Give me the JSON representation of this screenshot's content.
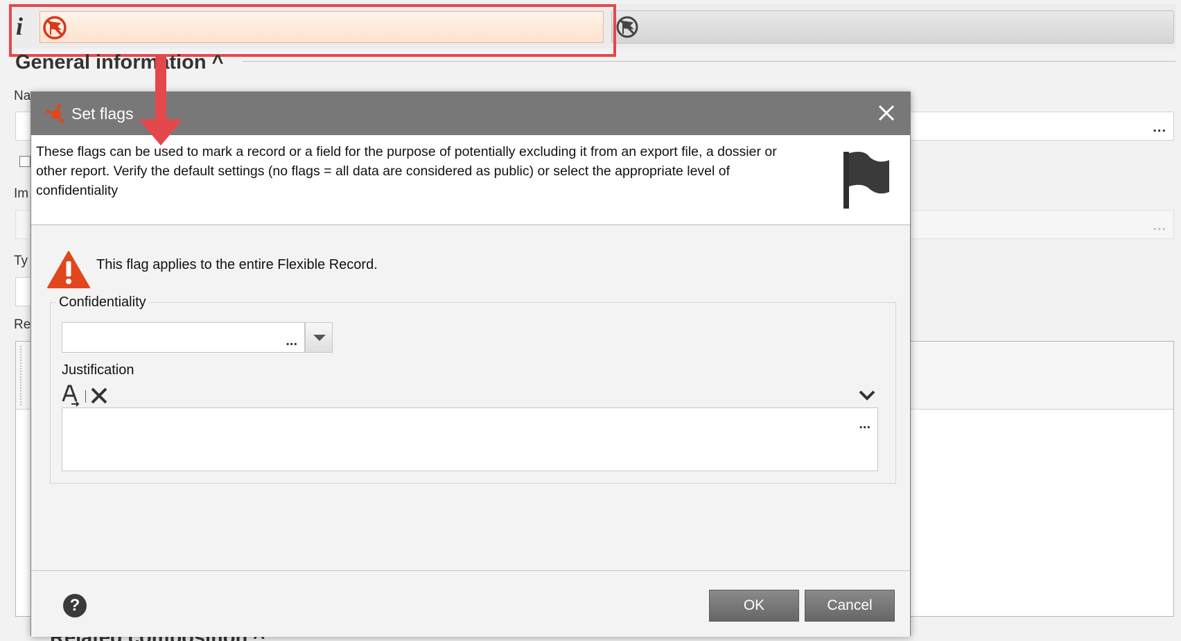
{
  "background": {
    "section_title": "General information ^",
    "labels": {
      "name": "Na",
      "impurity": "Im",
      "type": "Ty",
      "related": "Re"
    },
    "bottom_section_title": "Related composition ^",
    "field_dots": "..."
  },
  "flag_bar": {
    "info_icon": "i",
    "no_flag_icon": "no-flag-icon",
    "flag_icon": "flag-icon",
    "highlight_color": "#e4484c"
  },
  "dialog": {
    "title": "Set flags",
    "close_icon": "close-icon",
    "intro_text": "These flags can be used to mark a record or a field for the purpose of potentially excluding it from an export file, a dossier or other report. Verify the default settings (no flags = all data are considered as public) or select the appropriate level of confidentiality",
    "warning_text": "This flag applies to the entire Flexible Record.",
    "confidentiality_legend": "Confidentiality",
    "confidentiality_value": "",
    "confidentiality_dots": "...",
    "justification_label": "Justification",
    "justification_value": "",
    "justification_dots": "...",
    "help_symbol": "?",
    "ok_label": "OK",
    "cancel_label": "Cancel",
    "header_color": "#787878",
    "warning_color": "#e2461c"
  }
}
